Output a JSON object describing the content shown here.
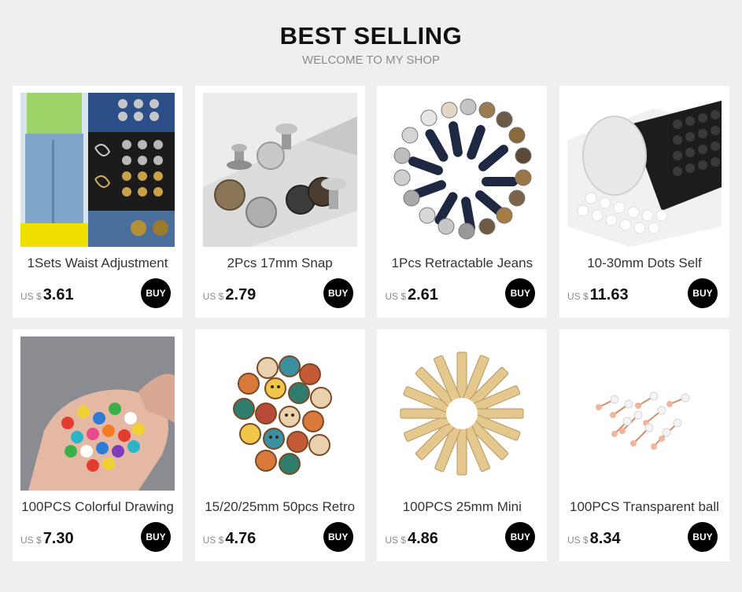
{
  "header": {
    "title": "BEST SELLING",
    "subtitle": "WELCOME TO MY SHOP"
  },
  "products": [
    {
      "name": "1Sets Waist Adjustment",
      "currency": "US $",
      "price": "3.61",
      "buy_label": "BUY",
      "image_icon": "jeans-button-hooks-photo"
    },
    {
      "name": "2Pcs 17mm Snap",
      "currency": "US $",
      "price": "2.79",
      "buy_label": "BUY",
      "image_icon": "snap-buttons-photo"
    },
    {
      "name": "1Pcs Retractable Jeans",
      "currency": "US $",
      "price": "2.61",
      "buy_label": "BUY",
      "image_icon": "button-ring-photo"
    },
    {
      "name": "10-30mm Dots Self",
      "currency": "US $",
      "price": "11.63",
      "buy_label": "BUY",
      "image_icon": "adhesive-dots-roll-photo"
    },
    {
      "name": "100PCS Colorful Drawing",
      "currency": "US $",
      "price": "7.30",
      "buy_label": "BUY",
      "image_icon": "colorful-pins-photo"
    },
    {
      "name": "15/20/25mm 50pcs Retro",
      "currency": "US $",
      "price": "4.76",
      "buy_label": "BUY",
      "image_icon": "wooden-buttons-photo"
    },
    {
      "name": "100PCS 25mm Mini",
      "currency": "US $",
      "price": "4.86",
      "buy_label": "BUY",
      "image_icon": "wooden-clothespins-photo"
    },
    {
      "name": "100PCS Transparent ball",
      "currency": "US $",
      "price": "8.34",
      "buy_label": "BUY",
      "image_icon": "ball-pins-photo"
    }
  ]
}
